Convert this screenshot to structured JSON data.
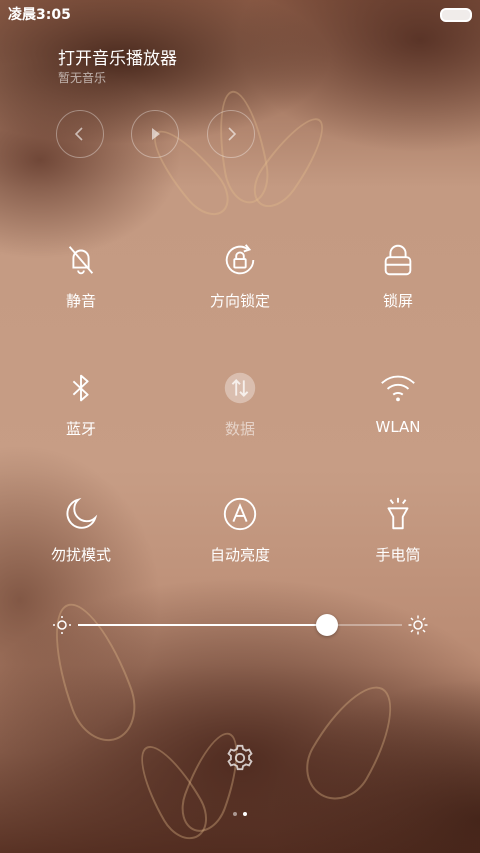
{
  "status_bar": {
    "time": "凌晨3:05"
  },
  "music": {
    "title": "打开音乐播放器",
    "subtitle": "暂无音乐",
    "controls": [
      "prev-icon",
      "play-icon",
      "next-icon"
    ]
  },
  "toggles": [
    {
      "label": "静音",
      "icon": "bell-off-icon",
      "active": false
    },
    {
      "label": "方向锁定",
      "icon": "rotation-lock-icon",
      "active": false
    },
    {
      "label": "锁屏",
      "icon": "lock-icon",
      "active": false
    },
    {
      "label": "蓝牙",
      "icon": "bluetooth-icon",
      "active": false
    },
    {
      "label": "数据",
      "icon": "mobile-data-icon",
      "active": false,
      "disabled": true
    },
    {
      "label": "WLAN",
      "icon": "wifi-icon",
      "active": false
    },
    {
      "label": "勿扰模式",
      "icon": "moon-icon",
      "active": false
    },
    {
      "label": "自动亮度",
      "icon": "auto-brightness-icon",
      "active": false
    },
    {
      "label": "手电筒",
      "icon": "flashlight-icon",
      "active": false
    }
  ],
  "brightness": {
    "level": 0.77
  },
  "pager": {
    "pages": 2,
    "current": 2
  },
  "colors": {
    "foreground": "#ffffff",
    "background": "#b98a72"
  }
}
